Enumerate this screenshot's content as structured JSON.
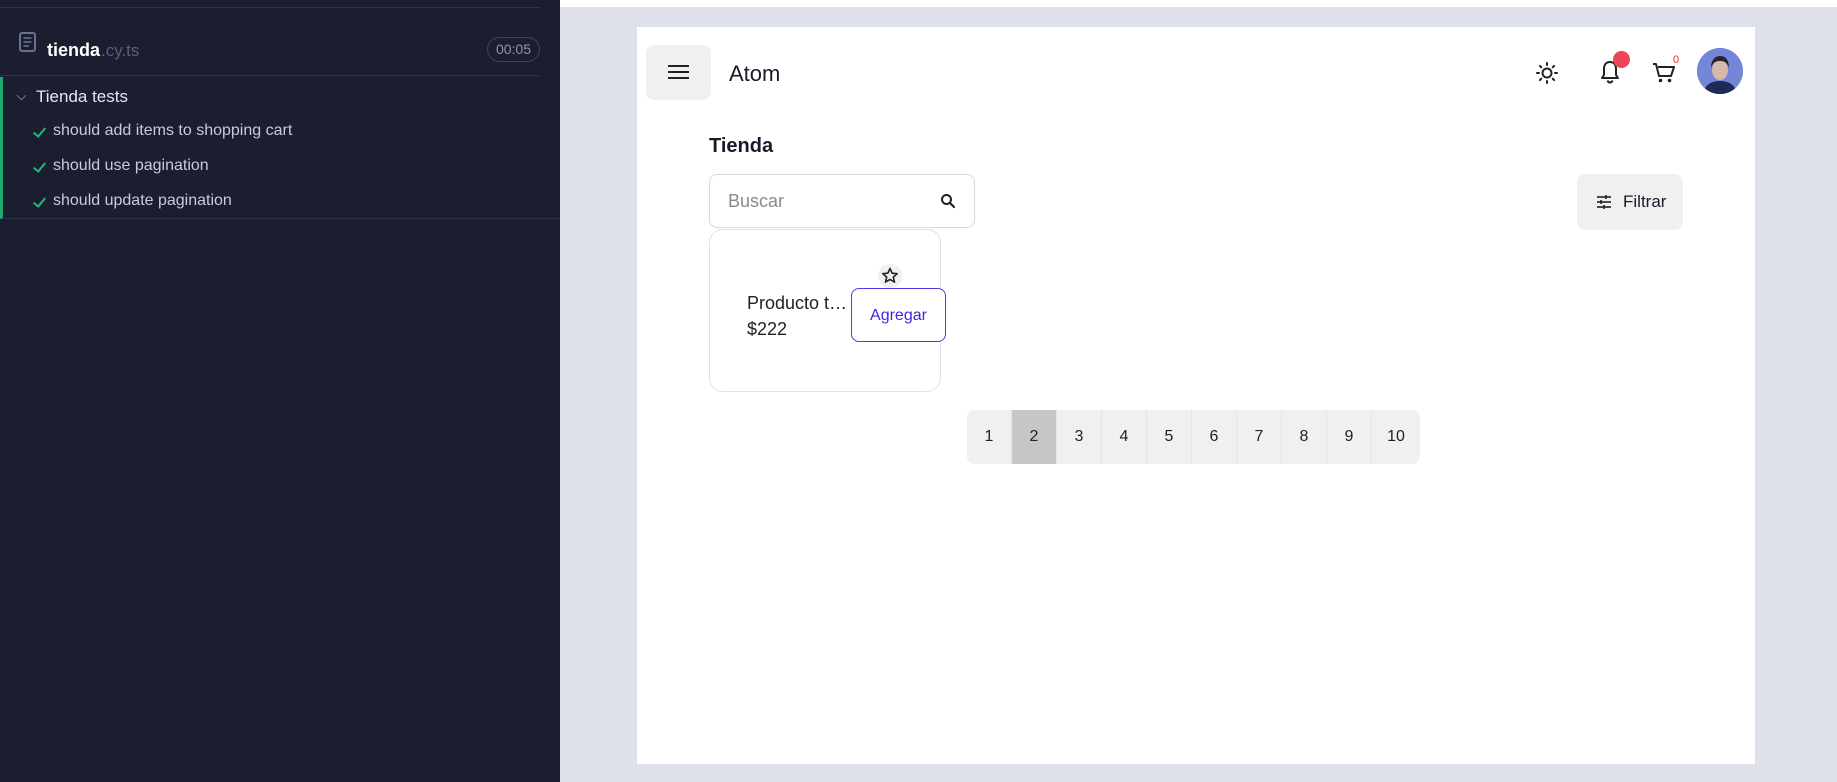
{
  "runner": {
    "spec": {
      "name": "tienda",
      "ext": ".cy.ts",
      "duration": "00:05",
      "icon": "document-icon"
    },
    "suite": {
      "title": "Tienda tests",
      "tests": [
        {
          "title": "should add items to shopping cart",
          "status": "passed"
        },
        {
          "title": "should use pagination",
          "status": "passed"
        },
        {
          "title": "should update pagination",
          "status": "passed"
        }
      ]
    },
    "colors": {
      "passed": "#1fb878",
      "background": "#1b1e2e"
    }
  },
  "app": {
    "brand": "Atom",
    "header_icons": [
      "menu-icon",
      "theme-sun-icon",
      "bell-icon",
      "cart-icon",
      "avatar"
    ],
    "cart_count": "0",
    "page_title": "Tienda",
    "search": {
      "placeholder": "Buscar",
      "value": ""
    },
    "filter_label": "Filtrar",
    "products": [
      {
        "name": "Producto test",
        "price": "$222",
        "add_label": "Agregar"
      }
    ],
    "pagination": {
      "pages": [
        "1",
        "2",
        "3",
        "4",
        "5",
        "6",
        "7",
        "8",
        "9",
        "10"
      ],
      "current": "2"
    },
    "colors": {
      "accent": "#4a21e0",
      "notification": "#ef4556",
      "cart_badge": "#e3202f"
    }
  }
}
